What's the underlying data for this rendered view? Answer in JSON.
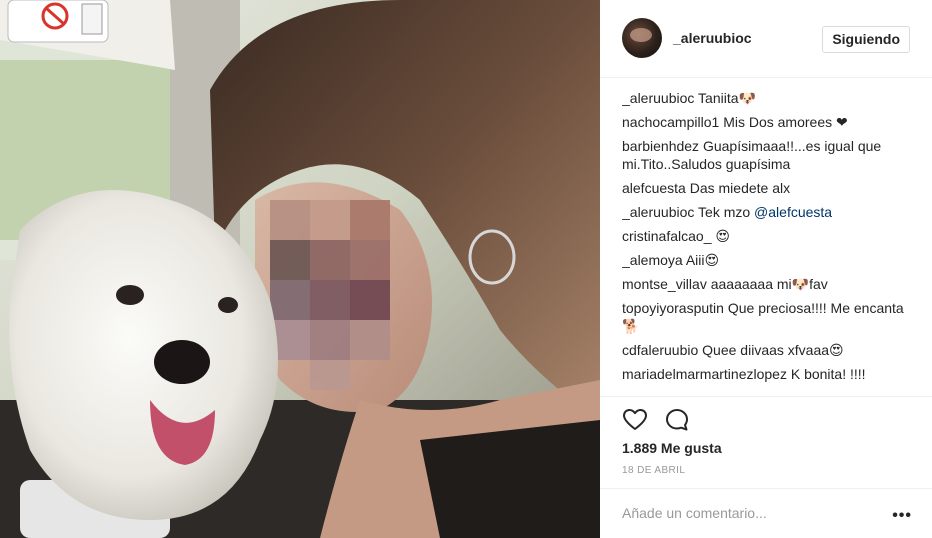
{
  "post": {
    "username": "_aleruubioc",
    "follow_label": "Siguiendo",
    "likes": "1.889 Me gusta",
    "date": "18 DE ABRIL",
    "comment_placeholder": "Añade un comentario...",
    "more_label": "•••"
  },
  "comments": [
    {
      "user": "_aleruubioc",
      "text": "Taniita🐶"
    },
    {
      "user": "nachocampillo1",
      "text": "Mis Dos amorees ❤"
    },
    {
      "user": "barbienhdez",
      "text": "Guapísimaaa!!...es igual que mi.Tito..Saludos guapísima"
    },
    {
      "user": "alefcuesta",
      "text": "Das miedete alx"
    },
    {
      "user": "_aleruubioc",
      "text": "Tek mzo ",
      "mention": "@alefcuesta"
    },
    {
      "user": "cristinafalcao_",
      "text": "😍"
    },
    {
      "user": "_alemoya",
      "text": "Aiii😍"
    },
    {
      "user": "montse_villav",
      "text": "aaaaaaaa mi🐶fav"
    },
    {
      "user": "topoyiyorasputin",
      "text": "Que preciosa!!!! Me encanta🐕"
    },
    {
      "user": "cdfaleruubio",
      "text": "Quee diivaas xfvaaa😍"
    },
    {
      "user": "mariadelmarmartinezlopez",
      "text": "K bonita! !!!!"
    }
  ],
  "icons": {
    "like": "heart-icon",
    "comment": "comment-bubble-icon",
    "options": "more-options-icon"
  },
  "colors": {
    "text": "#262626",
    "muted": "#999999",
    "border": "#efefef",
    "mention": "#003569"
  }
}
